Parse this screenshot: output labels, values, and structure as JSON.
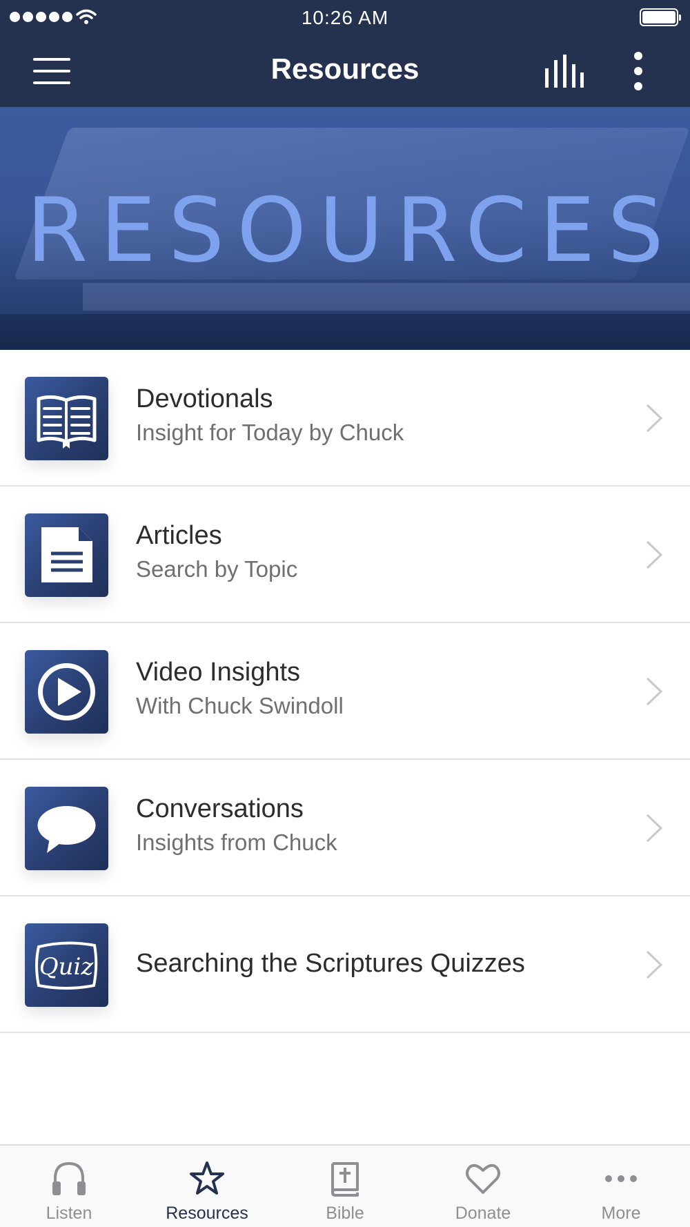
{
  "status_bar": {
    "time": "10:26 AM",
    "icons": [
      "signal-dots-icon",
      "wifi-icon",
      "battery-icon"
    ]
  },
  "nav": {
    "title": "Resources",
    "left_icon": "hamburger-menu-icon",
    "right_icons": [
      "equalizer-icon",
      "vertical-ellipsis-icon"
    ]
  },
  "hero": {
    "text": "RESOURCES"
  },
  "resources": [
    {
      "title": "Devotionals",
      "subtitle": "Insight for Today by Chuck",
      "icon": "open-book-icon"
    },
    {
      "title": "Articles",
      "subtitle": "Search by Topic",
      "icon": "document-icon"
    },
    {
      "title": "Video Insights",
      "subtitle": "With Chuck Swindoll",
      "icon": "play-circle-icon"
    },
    {
      "title": "Conversations",
      "subtitle": "Insights from Chuck",
      "icon": "speech-bubble-icon"
    },
    {
      "title": "Searching the Scriptures Quizzes",
      "subtitle": "",
      "icon": "quiz-icon",
      "icon_text": "Quiz"
    }
  ],
  "tabs": [
    {
      "label": "Listen",
      "icon": "headphones-icon",
      "active": false
    },
    {
      "label": "Resources",
      "icon": "star-icon",
      "active": true
    },
    {
      "label": "Bible",
      "icon": "bible-icon",
      "active": false
    },
    {
      "label": "Donate",
      "icon": "heart-icon",
      "active": false
    },
    {
      "label": "More",
      "icon": "horizontal-ellipsis-icon",
      "active": false
    }
  ],
  "colors": {
    "header_bg": "#25324f",
    "icon_tile": "#2a3f72",
    "hero_text": "#7ea2ee",
    "active_tab": "#25324f",
    "inactive_tab": "#8e8e93"
  }
}
